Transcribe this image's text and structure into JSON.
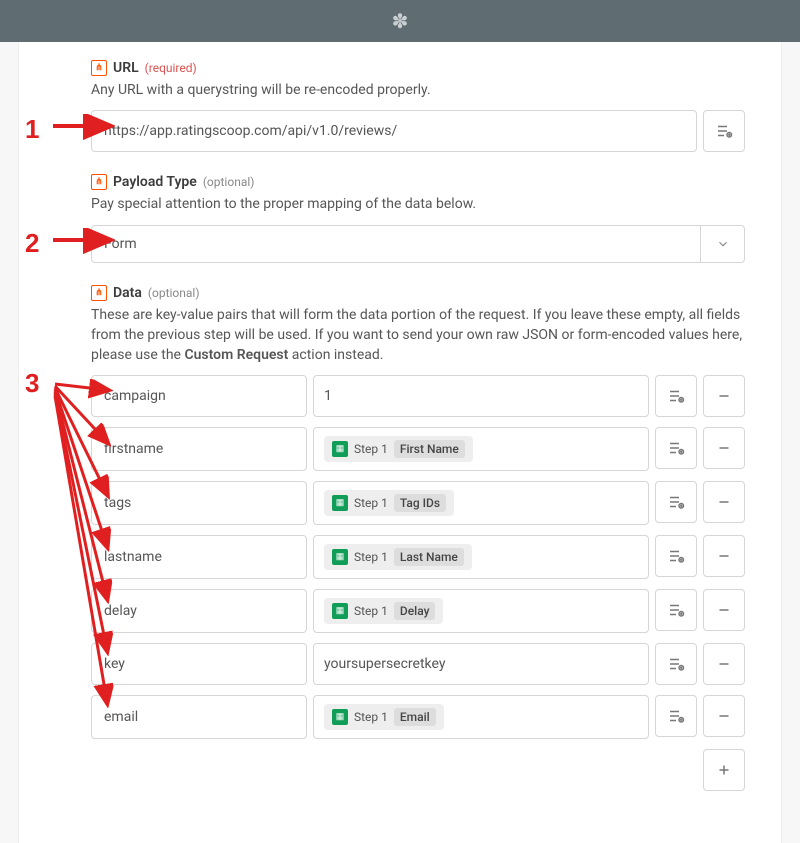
{
  "markers": {
    "one": "1",
    "two": "2",
    "three": "3"
  },
  "url_section": {
    "label": "URL",
    "required": "(required)",
    "helper": "Any URL with a querystring will be re-encoded properly.",
    "value": "https://app.ratingscoop.com/api/v1.0/reviews/"
  },
  "payload_section": {
    "label": "Payload Type",
    "optional": "(optional)",
    "helper": "Pay special attention to the proper mapping of the data below.",
    "value": "Form"
  },
  "data_section": {
    "label": "Data",
    "optional": "(optional)",
    "helper_pre": "These are key-value pairs that will form the data portion of the request. If you leave these empty, all fields from the previous step will be used. If you want to send your own raw JSON or form-encoded values here, please use the ",
    "helper_bold": "Custom Request",
    "helper_post": " action instead.",
    "step_prefix": "Step 1",
    "pairs": [
      {
        "key": "campaign",
        "value_type": "literal",
        "value": "1"
      },
      {
        "key": "firstname",
        "value_type": "pill",
        "pill_field": "First Name"
      },
      {
        "key": "tags",
        "value_type": "pill",
        "pill_field": "Tag IDs"
      },
      {
        "key": "lastname",
        "value_type": "pill",
        "pill_field": "Last Name"
      },
      {
        "key": "delay",
        "value_type": "pill",
        "pill_field": "Delay"
      },
      {
        "key": "key",
        "value_type": "literal",
        "value": "yoursupersecretkey"
      },
      {
        "key": "email",
        "value_type": "pill",
        "pill_field": "Email"
      }
    ]
  }
}
